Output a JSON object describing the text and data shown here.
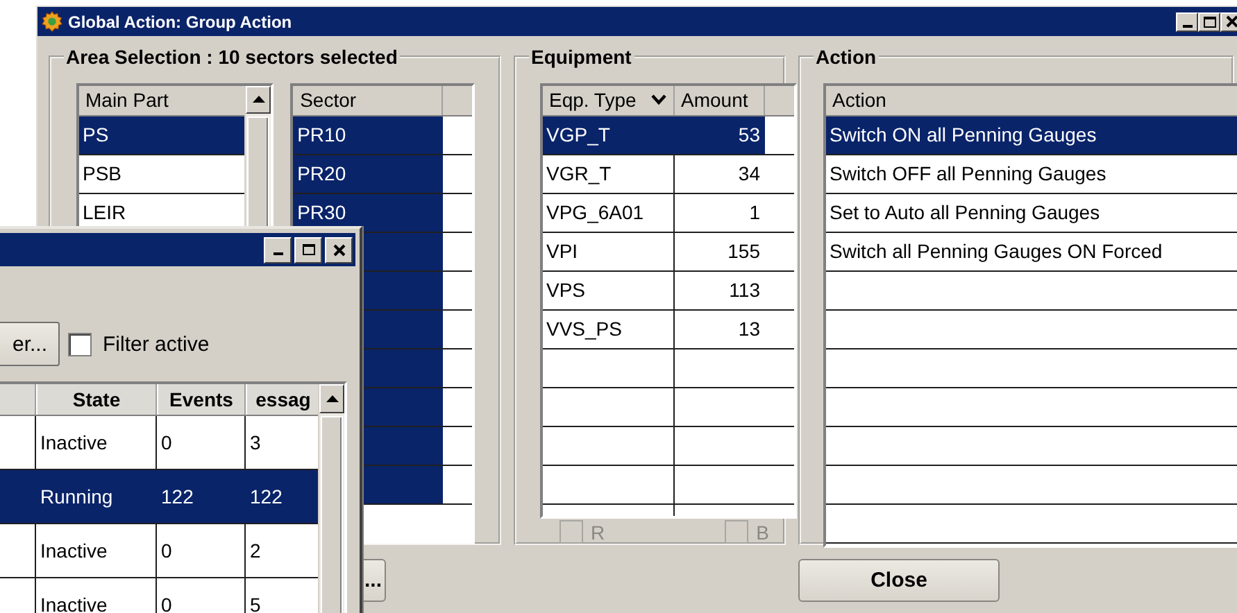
{
  "main_window": {
    "title": "Global Action: Group Action",
    "area_selection": {
      "title": "Area Selection : 10 sectors selected",
      "main_part": {
        "columns": [
          "Main Part"
        ],
        "rows": [
          {
            "label": "PS",
            "selected": true
          },
          {
            "label": "PSB",
            "selected": false
          },
          {
            "label": "LEIR",
            "selected": false
          }
        ]
      },
      "sector": {
        "columns": [
          "Sector"
        ],
        "rows": [
          {
            "label": "PR10",
            "selected": true
          },
          {
            "label": "PR20",
            "selected": true
          },
          {
            "label": "PR30",
            "selected": true
          },
          {
            "selected": true
          },
          {
            "selected": true
          },
          {
            "selected": true
          },
          {
            "selected": true
          },
          {
            "selected": true
          },
          {
            "selected": true
          },
          {
            "selected": true
          }
        ]
      }
    },
    "equipment": {
      "title": "Equipment",
      "columns": [
        "Eqp. Type",
        "Amount"
      ],
      "rows": [
        {
          "type": "VGP_T",
          "amount": "53",
          "selected": true
        },
        {
          "type": "VGR_T",
          "amount": "34",
          "selected": false
        },
        {
          "type": "VPG_6A01",
          "amount": "1",
          "selected": false
        },
        {
          "type": "VPI",
          "amount": "155",
          "selected": false
        },
        {
          "type": "VPS",
          "amount": "113",
          "selected": false
        },
        {
          "type": "VVS_PS",
          "amount": "13",
          "selected": false
        }
      ],
      "checkboxes": [
        {
          "label": "R",
          "checked": false,
          "disabled": true
        },
        {
          "label": "B",
          "checked": false,
          "disabled": true
        }
      ]
    },
    "action": {
      "title": "Action",
      "columns": [
        "Action"
      ],
      "rows": [
        {
          "label": "Switch ON all Penning Gauges",
          "selected": true
        },
        {
          "label": "Switch OFF all Penning Gauges",
          "selected": false
        },
        {
          "label": "Set to Auto all Penning Gauges",
          "selected": false
        },
        {
          "label": "Switch all Penning Gauges ON Forced",
          "selected": false
        }
      ]
    },
    "buttons": [
      {
        "label": "..."
      },
      {
        "label": "Close"
      }
    ]
  },
  "sub_window": {
    "filter_button": "er...",
    "filter_active": {
      "label": "Filter active",
      "checked": false
    },
    "table": {
      "columns": [
        "State",
        "Events",
        "essag"
      ],
      "rows": [
        {
          "state": "Inactive",
          "events": "0",
          "messages": "3",
          "selected": false
        },
        {
          "state": "Running",
          "events": "122",
          "messages": "122",
          "selected": true
        },
        {
          "state": "Inactive",
          "events": "0",
          "messages": "2",
          "selected": false
        },
        {
          "state": "Inactive",
          "events": "0",
          "messages": "5",
          "selected": false
        }
      ]
    }
  }
}
